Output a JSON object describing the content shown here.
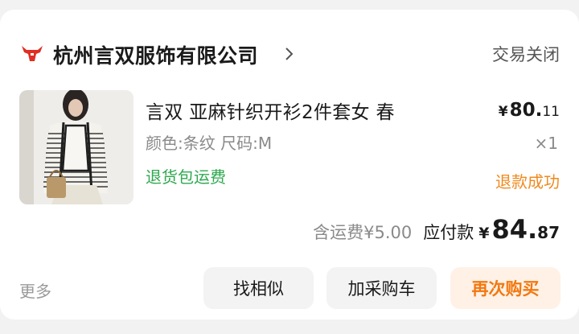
{
  "shop": {
    "name": "杭州言双服饰有限公司",
    "logo_icon": "bull-head-icon",
    "chevron_icon": "chevron-right-icon"
  },
  "order": {
    "status": "交易关闭",
    "product": {
      "title": "言双 亚麻针织开衫2件套女 春",
      "spec": "颜色:条纹 尺码:M",
      "service_tag": "退货包运费",
      "price_symbol": "¥",
      "price_integer": "80.",
      "price_decimal": "11",
      "quantity": "×1",
      "refund_status": "退款成功"
    },
    "totals": {
      "shipping_text": "含运费¥5.00",
      "pay_label": "应付款",
      "pay_symbol": "¥",
      "pay_integer": "84.",
      "pay_decimal": "87"
    }
  },
  "actions": {
    "more_label": "更多",
    "find_similar_label": "找相似",
    "add_cart_label": "加采购车",
    "rebuy_label": "再次购买"
  },
  "colors": {
    "brand_red": "#e02e24",
    "refund_orange": "#ef8a1f",
    "rebuy_orange": "#f2780f",
    "service_green": "#2fa84f"
  }
}
